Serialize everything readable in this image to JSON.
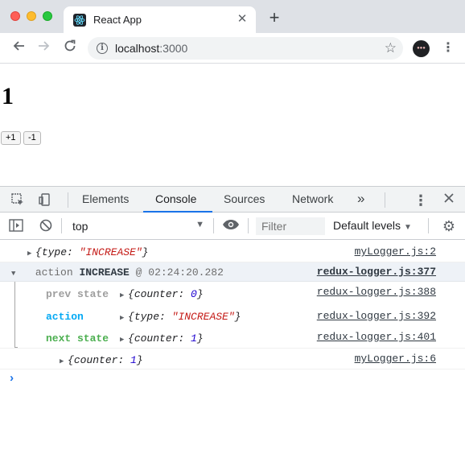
{
  "browser": {
    "tab_title": "React App",
    "tab_close": "✕",
    "new_tab": "+",
    "url_host": "localhost",
    "url_port": ":3000"
  },
  "page": {
    "counter": "1",
    "increment_label": "+1",
    "decrement_label": "-1"
  },
  "devtools": {
    "tabs": [
      "Elements",
      "Console",
      "Sources",
      "Network"
    ],
    "active_tab": "Console",
    "more_tabs": "»",
    "context": "top",
    "filter_placeholder": "Filter",
    "levels": "Default levels"
  },
  "console": {
    "entries": [
      {
        "text_prefix": "{",
        "key": "type",
        "sep": ": ",
        "value": "\"INCREASE\"",
        "text_suffix": "}",
        "source": "myLogger.js:2"
      },
      {
        "word": "action",
        "name": "INCREASE",
        "time": "@ 02:24:20.282",
        "source": "redux-logger.js:377"
      },
      {
        "label": "prev state",
        "text_prefix": "{",
        "key": "counter",
        "sep": ": ",
        "value": "0",
        "text_suffix": "}",
        "source": "redux-logger.js:388"
      },
      {
        "label": "action",
        "text_prefix": "{",
        "key": "type",
        "sep": ": ",
        "value": "\"INCREASE\"",
        "text_suffix": "}",
        "source": "redux-logger.js:392"
      },
      {
        "label": "next state",
        "text_prefix": "{",
        "key": "counter",
        "sep": ": ",
        "value": "1",
        "text_suffix": "}",
        "source": "redux-logger.js:401"
      },
      {
        "text_prefix": "{",
        "key": "counter",
        "sep": ": ",
        "value": "1",
        "text_suffix": "}",
        "source": "myLogger.js:6"
      }
    ],
    "prompt": "›"
  },
  "colors": {
    "prev_state": "#9e9e9e",
    "action": "#03a9f4",
    "next_state": "#4caf50",
    "accent": "#1a73e8"
  }
}
